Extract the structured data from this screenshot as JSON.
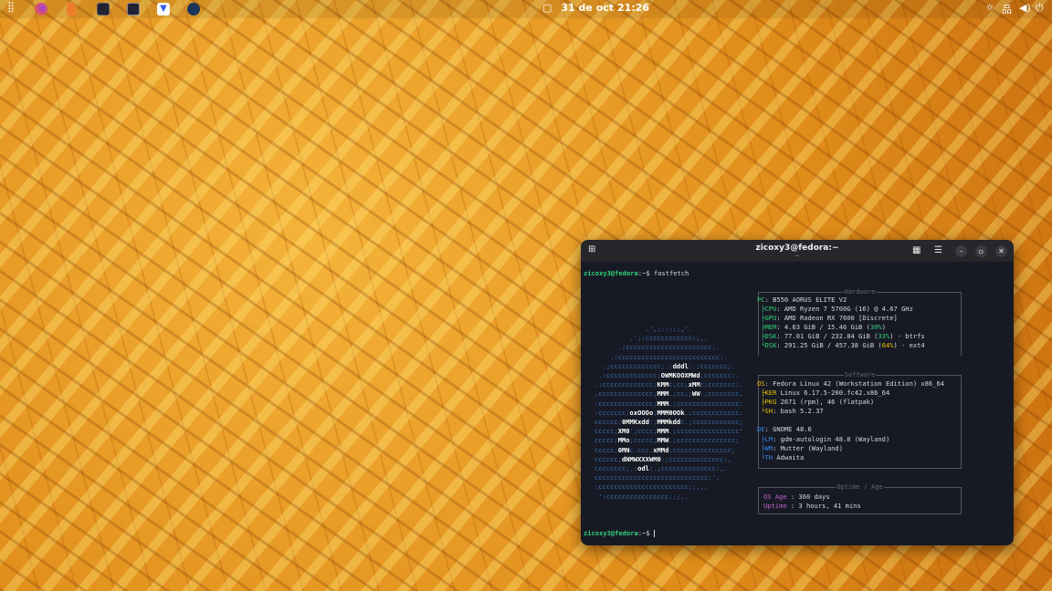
{
  "topbar": {
    "date": "31 de oct",
    "time": "21:26",
    "apps": [
      "app-grid",
      "firefox",
      "files",
      "terminal",
      "system-monitor",
      "downloader",
      "steam"
    ]
  },
  "terminal": {
    "title": "zicoxy3@fedora:~",
    "subtitle": "~",
    "prompt": "zicoxy3@fedora",
    "prompt_path": ":~$",
    "command": "fastfetch",
    "logo": [
      "             .',;::::;,'.",
      "         .';:cccccccccccc:;,.",
      "      .;cccccccccccccccccccccc;.",
      "    .:cccccccccccccccccccccccccc:.",
      "  .;ccccccccccccc;.:dddl:.;ccccccc;.",
      " .:ccccccccccccc;OWMKOOXMWd;ccccccc:.",
      ".:ccccccccccccc;KMMc;cc;xMMc;ccccccc:.",
      ",cccccccccccccc;MMM.;cc;;WW:;cccccccc,",
      ":cccccccccccccc;MMM.;cccccccccccccccc:",
      ":ccccccc;oxOOOo;MMM0OOk.;cccccccccccc:",
      "cccccc;0MMKxdd:;MMMkddc.;cccccccccccc;",
      "ccccc;XM0';cccc;MMM.;cccccccccccccccc'",
      "ccccc;MMo;ccccc;MMW.;ccccccccccccccc;",
      "ccccc;0MNc.ccc.xMMd;ccccccccccccccc;",
      "cccccc;dNMWXXXWM0:;cccccccccccccc:,",
      "cccccccc;.:odl:.;cccccccccccccc:,.",
      "ccccccccccccccccccccccccccccc:'.",
      ":ccccccccccccccccccccccc:;,..",
      " ':cccccccccccccccc::;,."
    ],
    "hardware": {
      "title": "Hardware",
      "pc": "B550 AORUS ELITE V2",
      "cpu": "AMD Ryzen 7 5700G (16) @ 4.67 GHz",
      "gpu": "AMD Radeon RX 7600 [Discrete]",
      "mem": "4.63 GiB / 15.46 GiB (",
      "mem_pct": "30%",
      "disk1": "77.01 GiB / 232.84 GiB (",
      "disk1_pct": "33%",
      "disk1_fs": ") - btrfs",
      "disk2": "291.25 GiB / 457.38 GiB (",
      "disk2_pct": "64%",
      "disk2_fs": ") - ext4"
    },
    "software": {
      "title": "Software",
      "os": "Fedora Linux 42 (Workstation Edition) x86_64",
      "kernel": "Linux 6.17.5-200.fc42.x86_64",
      "packages": "2671 (rpm), 46 (flatpak)",
      "shell": "bash 5.2.37",
      "de": "GNOME 48.6",
      "lm": "gdm-autologin 48.0 (Wayland)",
      "wm": "Mutter (Wayland)",
      "theme": "Adwaita"
    },
    "uptime": {
      "title": "Uptime / Age",
      "os_age_label": "OS Age",
      "os_age": " : 360 days",
      "uptime_label": "Uptime",
      "uptime": " : 3 hours, 41 mins"
    }
  }
}
